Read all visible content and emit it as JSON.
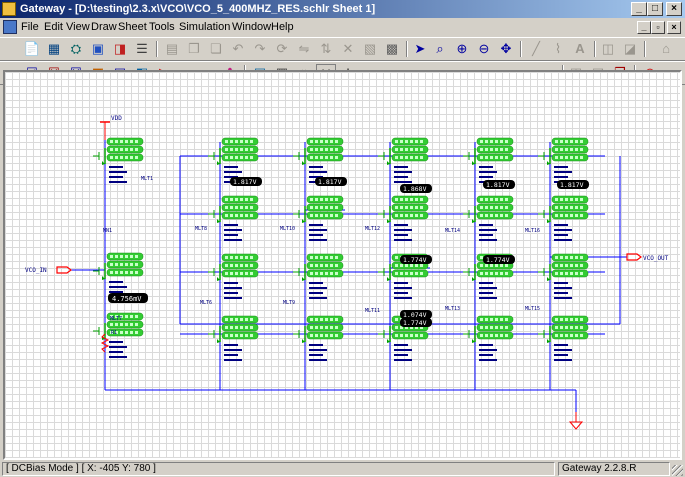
{
  "window": {
    "title": "Gateway - [D:\\testing\\2.3.x\\VCO\\VCO_5_400MHZ_RES.schlr Sheet 1]",
    "min_glyph": "_",
    "max_glyph": "□",
    "close_glyph": "×"
  },
  "menu": {
    "items": [
      "File",
      "Edit",
      "View",
      "Draw",
      "Sheet",
      "Tools",
      "Simulation",
      "Window",
      "Help"
    ],
    "mdi_min": "_",
    "mdi_restore": "▫",
    "mdi_close": "×"
  },
  "toolbar1": {
    "icons": [
      "new-icon",
      "open-icon",
      "library-icon",
      "save-icon",
      "import-icon",
      "print-icon",
      "cut-icon",
      "copy-icon",
      "paste-icon",
      "undo-icon",
      "redo-icon",
      "rotate-icon",
      "mirror-icon",
      "flip-icon",
      "delete-icon",
      "properties-icon",
      "grid-icon",
      "pointer-icon",
      "zoom-area-icon",
      "zoom-in-icon",
      "zoom-out-icon",
      "zoom-fit-icon",
      "wire-icon",
      "bus-icon",
      "text-icon",
      "tool-a-icon",
      "tool-b-icon",
      "help-icon"
    ]
  },
  "toolbar2": {
    "icons": [
      "check-icon",
      "erc-icon",
      "netlist-icon",
      "export-icon",
      "run-icon",
      "probe-icon",
      "play-icon",
      "stop-icon",
      "pause-icon",
      "record-icon",
      "analysis-icon",
      "dc-icon",
      "marker-icon"
    ],
    "voltage_button": "V",
    "current_button": "I"
  },
  "schematic": {
    "supply_label": "VDD",
    "input_label": "VCO_IN",
    "output_label": "VCO_OUT",
    "bias_voltage": "4.756mV",
    "stage_labels": [
      "MLT1",
      "MLT8",
      "MLT10",
      "MLT12",
      "MLT14",
      "MLT16",
      "MLT7",
      "MLT6",
      "MLT9",
      "MLT11",
      "MLT13",
      "MLT15"
    ],
    "probe_values": [
      "1.817V",
      "1.817V",
      "1.868V",
      "1.817V",
      "1.817V",
      "1.774V",
      "1.774V",
      "1.074V",
      "1.774V"
    ],
    "bias_device": "MN1",
    "resistor_label": "R1"
  },
  "status": {
    "mode": "[ DCBias Mode ] [ X: -405 Y: 780 ]",
    "version": "Gateway 2.2.8.R"
  },
  "colors": {
    "titlebar_start": "#0a246a",
    "titlebar_end": "#a6caf0",
    "wire": "#0000ff",
    "device_body": "#00a000",
    "annotation_bubble": "#33cc33",
    "probe_bubble": "#000000",
    "port": "#ff0000"
  }
}
